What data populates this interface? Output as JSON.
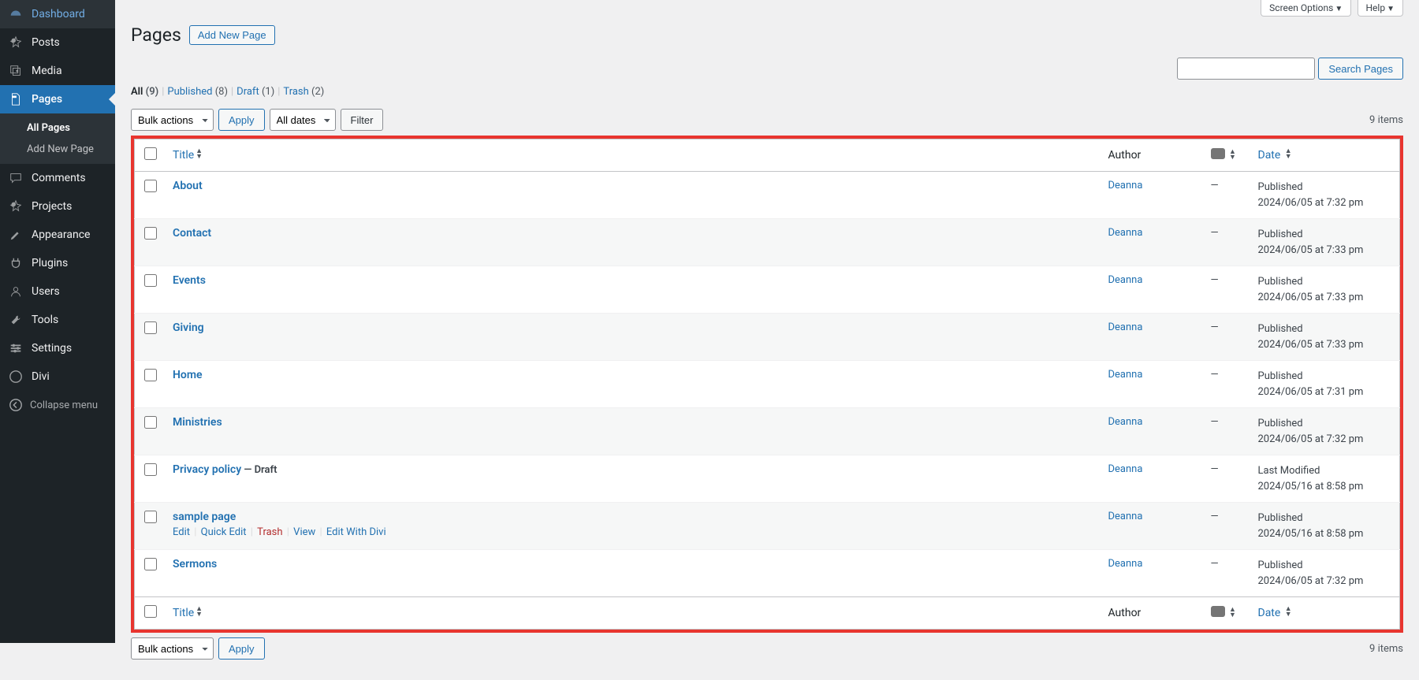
{
  "sidebar": {
    "items": [
      {
        "label": "Dashboard",
        "icon": "dashboard-icon"
      },
      {
        "label": "Posts",
        "icon": "pin-icon"
      },
      {
        "label": "Media",
        "icon": "media-icon"
      },
      {
        "label": "Pages",
        "icon": "pages-icon",
        "current": true,
        "submenu": [
          {
            "label": "All Pages",
            "current": true
          },
          {
            "label": "Add New Page"
          }
        ]
      },
      {
        "label": "Comments",
        "icon": "comments-icon"
      },
      {
        "label": "Projects",
        "icon": "pin-icon"
      },
      {
        "label": "Appearance",
        "icon": "appearance-icon"
      },
      {
        "label": "Plugins",
        "icon": "plugins-icon"
      },
      {
        "label": "Users",
        "icon": "users-icon"
      },
      {
        "label": "Tools",
        "icon": "tools-icon"
      },
      {
        "label": "Settings",
        "icon": "settings-icon"
      },
      {
        "label": "Divi",
        "icon": "divi-icon"
      }
    ],
    "collapse_label": "Collapse menu"
  },
  "screen_tabs": {
    "options": "Screen Options",
    "help": "Help"
  },
  "header": {
    "title": "Pages",
    "add_button": "Add New Page"
  },
  "filters": {
    "links": [
      {
        "label": "All",
        "count": "(9)",
        "current": true
      },
      {
        "label": "Published",
        "count": "(8)"
      },
      {
        "label": "Draft",
        "count": "(1)"
      },
      {
        "label": "Trash",
        "count": "(2)"
      }
    ]
  },
  "search": {
    "placeholder": "",
    "button": "Search Pages"
  },
  "tablenav": {
    "bulk_selected": "Bulk actions",
    "apply": "Apply",
    "dates_selected": "All dates",
    "filter": "Filter",
    "items_text": "9 items"
  },
  "columns": {
    "title": "Title",
    "author": "Author",
    "date": "Date"
  },
  "rows": [
    {
      "title": "About",
      "author": "Deanna",
      "comments": "—",
      "status": "Published",
      "date": "2024/06/05 at 7:32 pm"
    },
    {
      "title": "Contact",
      "author": "Deanna",
      "comments": "—",
      "status": "Published",
      "date": "2024/06/05 at 7:33 pm"
    },
    {
      "title": "Events",
      "author": "Deanna",
      "comments": "—",
      "status": "Published",
      "date": "2024/06/05 at 7:33 pm"
    },
    {
      "title": "Giving",
      "author": "Deanna",
      "comments": "—",
      "status": "Published",
      "date": "2024/06/05 at 7:33 pm"
    },
    {
      "title": "Home",
      "author": "Deanna",
      "comments": "—",
      "status": "Published",
      "date": "2024/06/05 at 7:31 pm"
    },
    {
      "title": "Ministries",
      "author": "Deanna",
      "comments": "—",
      "status": "Published",
      "date": "2024/06/05 at 7:32 pm"
    },
    {
      "title": "Privacy policy",
      "state": " — Draft",
      "author": "Deanna",
      "comments": "—",
      "status": "Last Modified",
      "date": "2024/05/16 at 8:58 pm"
    },
    {
      "title": "sample page",
      "author": "Deanna",
      "comments": "—",
      "status": "Published",
      "date": "2024/05/16 at 8:58 pm",
      "actions": [
        {
          "label": "Edit",
          "class": ""
        },
        {
          "label": "Quick Edit",
          "class": ""
        },
        {
          "label": "Trash",
          "class": "trash"
        },
        {
          "label": "View",
          "class": ""
        },
        {
          "label": "Edit With Divi",
          "class": ""
        }
      ]
    },
    {
      "title": "Sermons",
      "author": "Deanna",
      "comments": "—",
      "status": "Published",
      "date": "2024/06/05 at 7:32 pm"
    }
  ]
}
